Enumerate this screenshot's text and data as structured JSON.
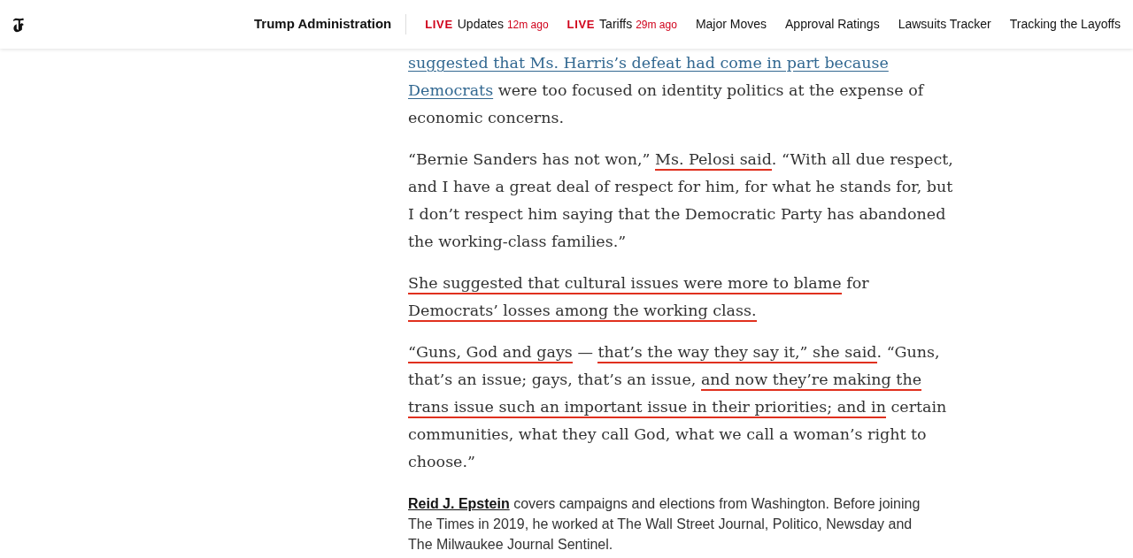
{
  "header": {
    "nav": [
      {
        "kind": "section",
        "label": "Trump Administration"
      },
      {
        "kind": "live",
        "live": "LIVE",
        "label": "Updates",
        "time": "12m ago"
      },
      {
        "kind": "live",
        "live": "LIVE",
        "label": "Tariffs",
        "time": "29m ago"
      },
      {
        "kind": "link",
        "label": "Major Moves"
      },
      {
        "kind": "link",
        "label": "Approval Ratings"
      },
      {
        "kind": "link",
        "label": "Lawsuits Tracker"
      },
      {
        "kind": "link",
        "label": "Tracking the Layoffs"
      }
    ]
  },
  "article": {
    "paragraphs": [
      [
        {
          "kind": "link",
          "text": "suggested that Ms. Harris’s defeat had come in part because"
        },
        {
          "kind": "link",
          "text": "Democrats"
        },
        {
          "kind": "plain",
          "text": " were too focused on identity politics at the expense of economic concerns."
        }
      ],
      [
        {
          "kind": "plain",
          "text": "“Bernie Sanders has not won,” "
        },
        {
          "kind": "marked",
          "text": "Ms. Pelosi said"
        },
        {
          "kind": "plain",
          "text": ". “With all due respect, and I have a great deal of respect for him, for what he stands for, but I don’t respect him saying that the Democratic Party has abandoned the working-class families.”"
        }
      ],
      [
        {
          "kind": "marked",
          "text": "She suggested that cultural issues were more to blame"
        },
        {
          "kind": "plain",
          "text": " for "
        },
        {
          "kind": "marked",
          "text": "Democrats’ losses among the working class."
        }
      ],
      [
        {
          "kind": "marked",
          "text": "“Guns, God and gays"
        },
        {
          "kind": "plain",
          "text": " — "
        },
        {
          "kind": "marked",
          "text": "that’s the way they say it,” she said"
        },
        {
          "kind": "plain",
          "text": ". “Guns, that’s an issue; gays, that’s an issue, "
        },
        {
          "kind": "marked",
          "text": "and now they’re making the trans issue such an important issue in their priorities; and in"
        },
        {
          "kind": "plain",
          "text": " certain communities, what they call God, what we call a woman’s right to choose.”"
        }
      ]
    ],
    "bio": [
      {
        "kind": "author",
        "text": "Reid J. Epstein"
      },
      {
        "kind": "plain",
        "text": " covers campaigns and elections from Washington. Before joining The Times in 2019, he worked at The Wall Street Journal, Politico, Newsday and The Milwaukee Journal Sentinel."
      }
    ]
  }
}
